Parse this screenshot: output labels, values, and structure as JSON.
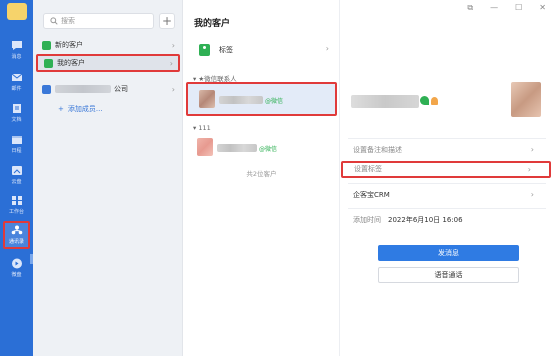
{
  "rail": {
    "items": [
      {
        "label": "消息",
        "icon": "chat-bubble-icon"
      },
      {
        "label": "邮件",
        "icon": "mail-icon"
      },
      {
        "label": "文档",
        "icon": "document-icon"
      },
      {
        "label": "日程",
        "icon": "calendar-icon"
      },
      {
        "label": "云盘",
        "icon": "cloud-drive-icon"
      },
      {
        "label": "工作台",
        "icon": "workbench-grid-icon"
      },
      {
        "label": "通讯录",
        "icon": "contacts-icon"
      },
      {
        "label": "微盘",
        "icon": "micro-drive-icon"
      }
    ]
  },
  "panel": {
    "search_placeholder": "搜索",
    "add_label": "+",
    "items": [
      {
        "label": "新的客户",
        "color": "#2fb054"
      },
      {
        "label": "我的客户",
        "color": "#2fb054"
      },
      {
        "label": "公司",
        "color": "#3a78d8"
      }
    ],
    "add_link": "添加成员..."
  },
  "mid": {
    "title": "我的客户",
    "tag_label": "标签",
    "section_starred": "★微信联系人",
    "section_group": "111",
    "contact1_tag": "@微信",
    "contact2_tag": "@微信",
    "count": "共2位客户"
  },
  "detail": {
    "row_note": "设置备注和描述",
    "row_tags": "设置标签",
    "row_crm": "企客宝CRM",
    "added_label": "添加时间",
    "added_value": "2022年6月10日 16:06",
    "send_button": "发消息",
    "voice_button": "语音通话"
  },
  "colors": {
    "rail": "#2b6fd6",
    "accent": "#2f7be3",
    "wechat_green": "#2fb054",
    "highlight": "#e03a3a"
  }
}
